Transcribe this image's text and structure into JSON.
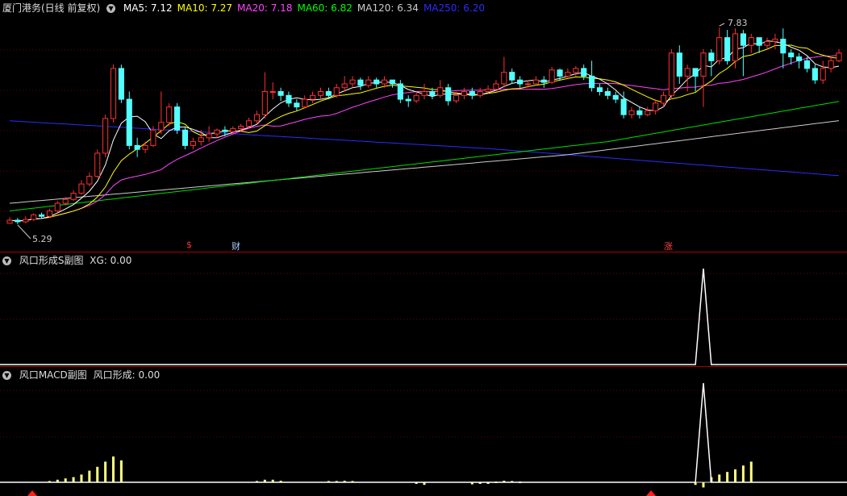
{
  "main": {
    "title": "厦门港务(日线 前复权)",
    "ma": [
      {
        "key": "ma5",
        "label": "MA5: 7.12",
        "color": "#ffffff"
      },
      {
        "key": "ma10",
        "label": "MA10: 7.27",
        "color": "#ffff00"
      },
      {
        "key": "ma20",
        "label": "MA20: 7.18",
        "color": "#ff44ff"
      },
      {
        "key": "ma60",
        "label": "MA60: 6.82",
        "color": "#00ff00"
      },
      {
        "key": "ma120",
        "label": "MA120: 6.34",
        "color": "#cccccc"
      },
      {
        "key": "ma250",
        "label": "MA250: 6.20",
        "color": "#2b2bff"
      }
    ],
    "high_label": "7.83",
    "low_label": "5.29",
    "markers": {
      "s": "$",
      "cai": "财",
      "zhang": "涨"
    },
    "price_range": [
      5.1,
      8.0
    ],
    "candles": [
      [
        5.29,
        5.33,
        5.29,
        5.37
      ],
      [
        5.33,
        5.31,
        5.28,
        5.36
      ],
      [
        5.31,
        5.34,
        5.29,
        5.38
      ],
      [
        5.34,
        5.4,
        5.32,
        5.42
      ],
      [
        5.4,
        5.38,
        5.35,
        5.43
      ],
      [
        5.38,
        5.45,
        5.36,
        5.48
      ],
      [
        5.45,
        5.55,
        5.43,
        5.58
      ],
      [
        5.55,
        5.6,
        5.52,
        5.63
      ],
      [
        5.6,
        5.68,
        5.58,
        5.72
      ],
      [
        5.68,
        5.8,
        5.66,
        5.85
      ],
      [
        5.8,
        5.9,
        5.77,
        5.95
      ],
      [
        5.9,
        6.2,
        5.88,
        6.25
      ],
      [
        6.2,
        6.65,
        6.15,
        6.7
      ],
      [
        6.65,
        7.3,
        6.6,
        7.35
      ],
      [
        7.3,
        6.9,
        6.85,
        7.35
      ],
      [
        6.9,
        6.3,
        6.25,
        7.0
      ],
      [
        6.3,
        6.25,
        6.15,
        6.4
      ],
      [
        6.25,
        6.3,
        6.2,
        6.35
      ],
      [
        6.3,
        6.5,
        6.28,
        6.55
      ],
      [
        6.5,
        6.6,
        6.45,
        7.0
      ],
      [
        6.6,
        6.8,
        6.55,
        6.85
      ],
      [
        6.8,
        6.5,
        6.45,
        6.85
      ],
      [
        6.5,
        6.3,
        6.25,
        6.55
      ],
      [
        6.3,
        6.35,
        6.25,
        6.4
      ],
      [
        6.35,
        6.4,
        6.3,
        6.5
      ],
      [
        6.4,
        6.45,
        6.35,
        6.55
      ],
      [
        6.45,
        6.5,
        6.4,
        6.52
      ],
      [
        6.5,
        6.48,
        6.42,
        6.55
      ],
      [
        6.48,
        6.52,
        6.45,
        6.55
      ],
      [
        6.52,
        6.55,
        6.48,
        6.58
      ],
      [
        6.55,
        6.62,
        6.52,
        6.66
      ],
      [
        6.62,
        6.7,
        6.58,
        6.75
      ],
      [
        6.7,
        7.0,
        6.65,
        7.25
      ],
      [
        7.0,
        7.0,
        6.9,
        7.12
      ],
      [
        7.0,
        6.95,
        6.88,
        7.05
      ],
      [
        6.95,
        6.85,
        6.8,
        7.0
      ],
      [
        6.85,
        6.8,
        6.75,
        6.9
      ],
      [
        6.8,
        6.9,
        6.78,
        6.95
      ],
      [
        6.9,
        6.95,
        6.85,
        7.0
      ],
      [
        6.95,
        7.0,
        6.9,
        7.05
      ],
      [
        7.0,
        6.95,
        6.9,
        7.05
      ],
      [
        6.95,
        7.05,
        6.92,
        7.1
      ],
      [
        7.05,
        7.1,
        7.0,
        7.2
      ],
      [
        7.1,
        7.15,
        7.05,
        7.2
      ],
      [
        7.15,
        7.08,
        7.02,
        7.18
      ],
      [
        7.08,
        7.15,
        7.05,
        7.2
      ],
      [
        7.15,
        7.1,
        7.05,
        7.18
      ],
      [
        7.1,
        7.15,
        7.05,
        7.2
      ],
      [
        7.15,
        7.1,
        7.05,
        7.15
      ],
      [
        7.1,
        6.9,
        6.85,
        7.15
      ],
      [
        6.9,
        6.88,
        6.8,
        6.95
      ],
      [
        6.88,
        6.95,
        6.85,
        7.0
      ],
      [
        6.95,
        7.0,
        6.9,
        7.1
      ],
      [
        7.0,
        6.95,
        6.9,
        7.05
      ],
      [
        6.95,
        7.05,
        6.92,
        7.15
      ],
      [
        7.05,
        6.88,
        6.82,
        7.1
      ],
      [
        6.88,
        6.95,
        6.85,
        7.0
      ],
      [
        6.95,
        7.0,
        6.9,
        7.05
      ],
      [
        7.0,
        6.95,
        6.9,
        7.05
      ],
      [
        6.95,
        7.0,
        6.92,
        7.05
      ],
      [
        7.0,
        7.03,
        6.98,
        7.08
      ],
      [
        7.03,
        7.1,
        7.0,
        7.15
      ],
      [
        7.1,
        7.25,
        7.05,
        7.45
      ],
      [
        7.25,
        7.15,
        7.1,
        7.3
      ],
      [
        7.15,
        7.1,
        7.05,
        7.2
      ],
      [
        7.1,
        7.1,
        7.05,
        7.15
      ],
      [
        7.1,
        7.15,
        7.08,
        7.2
      ],
      [
        7.15,
        7.12,
        7.05,
        7.2
      ],
      [
        7.12,
        7.28,
        7.1,
        7.32
      ],
      [
        7.28,
        7.2,
        7.15,
        7.3
      ],
      [
        7.2,
        7.25,
        7.18,
        7.3
      ],
      [
        7.25,
        7.3,
        7.2,
        7.33
      ],
      [
        7.3,
        7.2,
        7.15,
        7.35
      ],
      [
        7.2,
        7.05,
        7.0,
        7.4
      ],
      [
        7.05,
        7.0,
        6.95,
        7.1
      ],
      [
        7.0,
        6.95,
        6.9,
        7.05
      ],
      [
        6.95,
        6.9,
        6.85,
        7.0
      ],
      [
        6.9,
        6.7,
        6.65,
        7.0
      ],
      [
        6.7,
        6.75,
        6.65,
        6.8
      ],
      [
        6.75,
        6.7,
        6.65,
        6.8
      ],
      [
        6.7,
        6.75,
        6.68,
        6.8
      ],
      [
        6.75,
        6.85,
        6.7,
        6.9
      ],
      [
        6.85,
        6.95,
        6.8,
        7.0
      ],
      [
        6.95,
        7.5,
        6.9,
        7.55
      ],
      [
        7.5,
        7.2,
        7.1,
        7.6
      ],
      [
        7.2,
        7.3,
        7.0,
        7.35
      ],
      [
        7.3,
        7.2,
        7.0,
        7.3
      ],
      [
        7.2,
        7.5,
        6.8,
        7.55
      ],
      [
        7.5,
        7.4,
        7.2,
        7.55
      ],
      [
        7.4,
        7.7,
        7.35,
        7.83
      ],
      [
        7.7,
        7.4,
        7.35,
        7.8
      ],
      [
        7.4,
        7.75,
        7.3,
        7.82
      ],
      [
        7.75,
        7.6,
        7.2,
        7.8
      ],
      [
        7.6,
        7.7,
        7.5,
        7.75
      ],
      [
        7.7,
        7.6,
        7.5,
        7.7
      ],
      [
        7.6,
        7.65,
        7.55,
        7.7
      ],
      [
        7.65,
        7.68,
        7.55,
        7.75
      ],
      [
        7.68,
        7.5,
        7.3,
        7.82
      ],
      [
        7.5,
        7.45,
        7.35,
        7.55
      ],
      [
        7.45,
        7.4,
        7.3,
        7.5
      ],
      [
        7.4,
        7.3,
        7.25,
        7.45
      ],
      [
        7.3,
        7.15,
        7.1,
        7.35
      ],
      [
        7.15,
        7.3,
        7.1,
        7.4
      ],
      [
        7.3,
        7.4,
        7.25,
        7.45
      ],
      [
        7.4,
        7.5,
        7.38,
        7.55
      ]
    ]
  },
  "xg": {
    "title": "风口形成S副图",
    "value": "XG: 0.00",
    "spike_index": 87
  },
  "macd": {
    "title": "风口MACD副图",
    "value": "风口形成: 0.00",
    "spike_index": 87,
    "bars": [
      {
        "i": 5,
        "v": 0.05
      },
      {
        "i": 6,
        "v": 0.1
      },
      {
        "i": 7,
        "v": 0.15
      },
      {
        "i": 8,
        "v": 0.2
      },
      {
        "i": 9,
        "v": 0.3
      },
      {
        "i": 10,
        "v": 0.45
      },
      {
        "i": 11,
        "v": 0.6
      },
      {
        "i": 12,
        "v": 0.8
      },
      {
        "i": 13,
        "v": 1.0
      },
      {
        "i": 14,
        "v": 0.85
      },
      {
        "i": 31,
        "v": 0.05
      },
      {
        "i": 32,
        "v": 0.1
      },
      {
        "i": 33,
        "v": 0.1
      },
      {
        "i": 34,
        "v": 0.06
      },
      {
        "i": 40,
        "v": 0.05
      },
      {
        "i": 41,
        "v": 0.05
      },
      {
        "i": 42,
        "v": 0.06
      },
      {
        "i": 43,
        "v": 0.05
      },
      {
        "i": 51,
        "v": -0.05
      },
      {
        "i": 52,
        "v": -0.1
      },
      {
        "i": 58,
        "v": -0.08
      },
      {
        "i": 59,
        "v": -0.06
      },
      {
        "i": 60,
        "v": -0.04
      },
      {
        "i": 61,
        "v": 0.03
      },
      {
        "i": 62,
        "v": 0.06
      },
      {
        "i": 63,
        "v": 0.05
      },
      {
        "i": 64,
        "v": 0.03
      },
      {
        "i": 86,
        "v": -0.1
      },
      {
        "i": 87,
        "v": -0.2
      },
      {
        "i": 88,
        "v": 0.2
      },
      {
        "i": 89,
        "v": 0.3
      },
      {
        "i": 90,
        "v": 0.4
      },
      {
        "i": 91,
        "v": 0.5
      },
      {
        "i": 92,
        "v": 0.65
      },
      {
        "i": 93,
        "v": 0.8
      }
    ]
  }
}
